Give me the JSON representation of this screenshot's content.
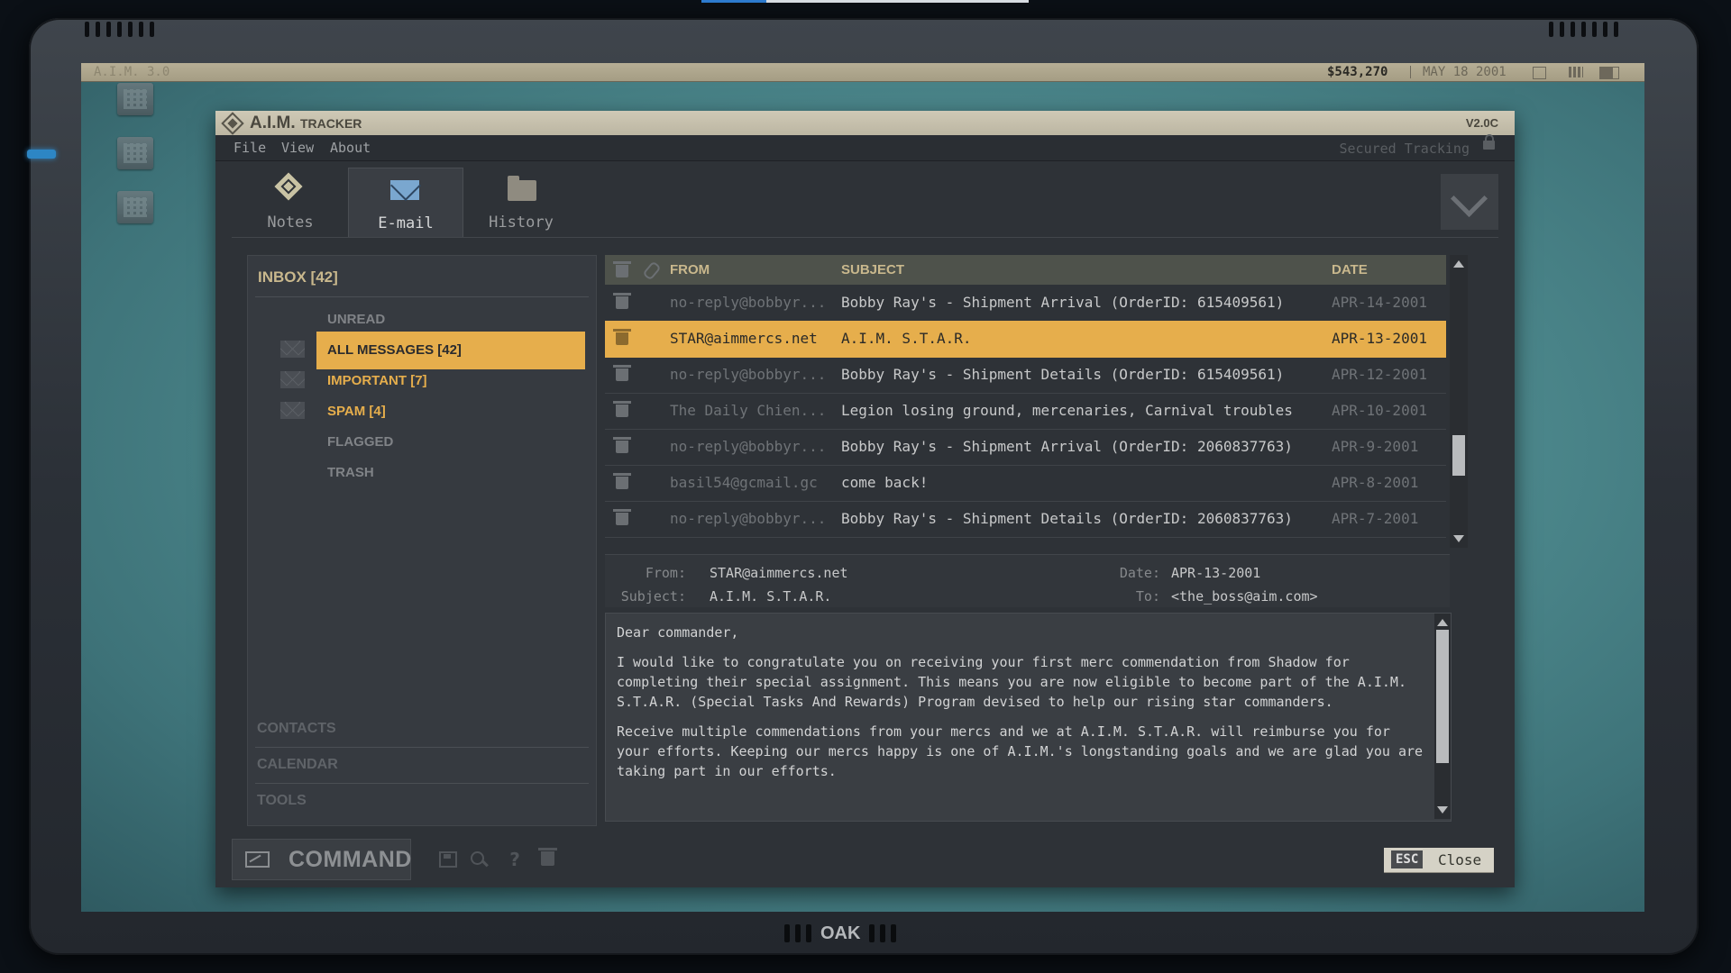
{
  "os_bar": {
    "title": "A.I.M. 3.0",
    "money": "$543,270",
    "date": "MAY 18 2001"
  },
  "window": {
    "title": "A.I.M.",
    "title_suffix": "TRACKER",
    "version": "V2.0C",
    "menu": [
      "File",
      "View",
      "About"
    ],
    "secured_label": "Secured Tracking"
  },
  "tabs": [
    {
      "label": "Notes",
      "icon": "notes-icon",
      "active": false
    },
    {
      "label": "E-mail",
      "icon": "mail-icon",
      "active": true
    },
    {
      "label": "History",
      "icon": "folder-icon",
      "active": false
    }
  ],
  "folders": {
    "inbox_title": "INBOX [42]",
    "items": [
      {
        "label": "UNREAD"
      },
      {
        "label": "ALL MESSAGES [42]",
        "selected": true
      },
      {
        "label": "IMPORTANT [7]"
      },
      {
        "label": "SPAM [4]"
      },
      {
        "label": "FLAGGED"
      },
      {
        "label": "TRASH"
      }
    ],
    "nav": [
      "CONTACTS",
      "CALENDAR",
      "TOOLS"
    ]
  },
  "message_list": {
    "columns": {
      "from": "FROM",
      "subject": "SUBJECT",
      "date": "DATE"
    },
    "rows": [
      {
        "from": "no-reply@bobbyr...",
        "subject": "Bobby Ray's - Shipment Arrival (OrderID: 615409561)",
        "date": "APR-14-2001"
      },
      {
        "from": "STAR@aimmercs.net",
        "subject": "A.I.M. S.T.A.R.",
        "date": "APR-13-2001",
        "selected": true
      },
      {
        "from": "no-reply@bobbyr...",
        "subject": "Bobby Ray's - Shipment Details (OrderID: 615409561)",
        "date": "APR-12-2001"
      },
      {
        "from": "The Daily Chien...",
        "subject": "Legion losing ground, mercenaries, Carnival troubles",
        "date": "APR-10-2001"
      },
      {
        "from": "no-reply@bobbyr...",
        "subject": "Bobby Ray's - Shipment Arrival (OrderID: 2060837763)",
        "date": "APR-9-2001"
      },
      {
        "from": "basil54@gcmail.gc",
        "subject": "come back!",
        "date": "APR-8-2001"
      },
      {
        "from": "no-reply@bobbyr...",
        "subject": "Bobby Ray's - Shipment Details (OrderID: 2060837763)",
        "date": "APR-7-2001"
      }
    ]
  },
  "preview": {
    "from_label": "From:",
    "from": "STAR@aimmercs.net",
    "subject_label": "Subject:",
    "subject": "A.I.M. S.T.A.R.",
    "date_label": "Date:",
    "date": "APR-13-2001",
    "to_label": "To:",
    "to": "<the_boss@aim.com>",
    "body": {
      "p1": "Dear commander,",
      "p2": "I would like to congratulate you on receiving your first merc commendation from Shadow for completing their special assignment. This means you are now eligible to become part of the A.I.M. S.T.A.R. (Special Tasks And Rewards) Program devised to help our rising star commanders.",
      "p3": "Receive multiple commendations from your mercs and we at A.I.M. S.T.A.R. will reimburse you for your efforts. Keeping our mercs happy is one of A.I.M.'s longstanding goals and we are glad you are taking part in our efforts."
    }
  },
  "bottom_bar": {
    "command_label": "COMMAND",
    "esc_key": "ESC",
    "close_label": "Close"
  },
  "brand": "OAK",
  "colors": {
    "accent": "#e6ae4c",
    "header_text": "#c9b88d",
    "window_bg": "#2e3237",
    "titlebar": "#c6c0ac",
    "desktop": "#5a9497"
  }
}
